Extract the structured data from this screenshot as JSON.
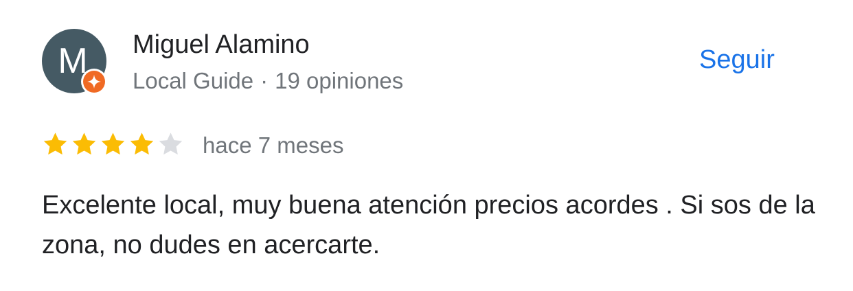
{
  "reviewer": {
    "initial": "M",
    "name": "Miguel Alamino",
    "badge": "Local Guide",
    "separator": "·",
    "review_count": "19 opiniones",
    "avatar_color": "#455a64",
    "badge_icon": "local-guide-star-icon",
    "badge_color": "#f06a24"
  },
  "follow": {
    "label": "Seguir",
    "color": "#1a73e8"
  },
  "review": {
    "rating": 4,
    "max_rating": 5,
    "star_filled_color": "#fbbc04",
    "star_empty_color": "#dadce0",
    "date": "hace 7 meses",
    "text": "Excelente local, muy buena atención precios acordes . Si sos de la zona, no dudes en acercarte."
  }
}
